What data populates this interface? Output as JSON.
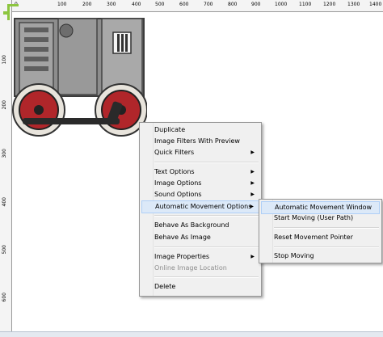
{
  "ruler": {
    "top_marks": [
      "0",
      "100",
      "200",
      "300",
      "400",
      "500",
      "600",
      "700",
      "800",
      "900",
      "1000",
      "1100",
      "1200",
      "1300",
      "1400"
    ],
    "left_marks": [
      "100",
      "200",
      "300",
      "400",
      "500",
      "600"
    ]
  },
  "context_menu": {
    "items": {
      "duplicate": "Duplicate",
      "image_filters": "Image Filters With Preview",
      "quick_filters": "Quick Filters",
      "text_options": "Text Options",
      "image_options": "Image Options",
      "sound_options": "Sound Options",
      "auto_movement": "Automatic Movement Options",
      "behave_bg": "Behave As Background",
      "behave_image": "Behave As Image",
      "image_props": "Image Properties",
      "online_location": "Online Image Location",
      "delete": "Delete"
    },
    "arrow": "▶"
  },
  "submenu": {
    "items": {
      "auto_window": "Automatic Movement Window",
      "start_moving": "Start Moving (User Path)",
      "reset_pointer": "Reset Movement Pointer",
      "stop_moving": "Stop Moving"
    }
  }
}
